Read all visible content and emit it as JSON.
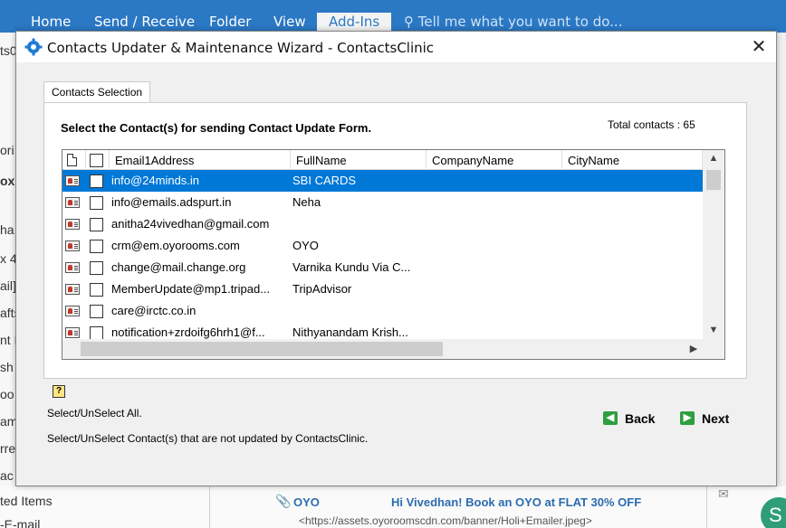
{
  "ribbon": {
    "tabs": [
      "Home",
      "Send / Receive",
      "Folder",
      "View",
      "Add-Ins"
    ],
    "active_tab": "Add-Ins",
    "tell_me": "Tell me what you want to do..."
  },
  "background": {
    "left_fragments": [
      "ts0",
      "ori",
      "ox",
      "ha",
      "x 4",
      "ail]",
      "afts",
      "nt M",
      "sh",
      "oo",
      "am",
      "rre",
      "ac"
    ],
    "deleted_items": "ted Items",
    "mail_snip": "-E-mail",
    "message": {
      "sender": "OYO",
      "subject": "Hi Vivedhan! Book an OYO at FLAT 30% OFF",
      "preview": "<https://assets.oyoroomscdn.com/banner/Holi+Emailer.jpeg>"
    },
    "avatar_letter": "S"
  },
  "dialog": {
    "title": "Contacts Updater & Maintenance Wizard - ContactsClinic",
    "tab_label": "Contacts Selection",
    "heading": "Select the Contact(s) for sending Contact Update Form.",
    "total_label": "Total contacts :",
    "total_value": "65",
    "columns": [
      "Email1Address",
      "FullName",
      "CompanyName",
      "CityName"
    ],
    "rows": [
      {
        "email": "info@24minds.in",
        "fullname": "SBI CARDS",
        "company": "",
        "city": "",
        "selected": true
      },
      {
        "email": "info@emails.adspurt.in",
        "fullname": "Neha",
        "company": "",
        "city": "",
        "selected": false
      },
      {
        "email": "anitha24vivedhan@gmail.com",
        "fullname": "",
        "company": "",
        "city": "",
        "selected": false
      },
      {
        "email": "crm@em.oyorooms.com",
        "fullname": "OYO",
        "company": "",
        "city": "",
        "selected": false
      },
      {
        "email": "change@mail.change.org",
        "fullname": "Varnika Kundu Via C...",
        "company": "",
        "city": "",
        "selected": false
      },
      {
        "email": "MemberUpdate@mp1.tripad...",
        "fullname": "TripAdvisor",
        "company": "",
        "city": "",
        "selected": false
      },
      {
        "email": "care@irctc.co.in",
        "fullname": "",
        "company": "",
        "city": "",
        "selected": false
      },
      {
        "email": "notification+zrdoifg6hrh1@f...",
        "fullname": "Nithyanandam Krish...",
        "company": "",
        "city": "",
        "selected": false
      }
    ],
    "select_all_label": "Select/UnSelect All.",
    "select_not_updated_label": "Select/UnSelect Contact(s) that are not updated by ContactsClinic.",
    "back_label": "Back",
    "next_label": "Next",
    "help_symbol": "?"
  }
}
